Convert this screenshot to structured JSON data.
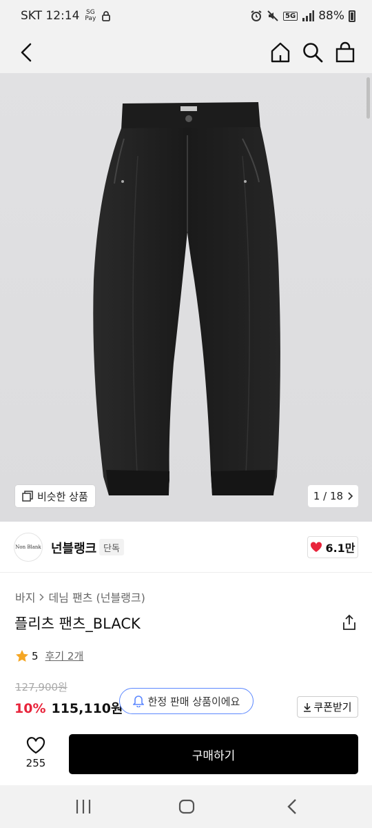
{
  "status_bar": {
    "carrier_time": "SKT 12:14",
    "pay_label_top": "SG",
    "pay_label_bottom": "Pay",
    "network": "5G",
    "battery": "88%",
    "icons": [
      "alarm-icon",
      "mute-icon",
      "signal-icon",
      "battery-icon",
      "lock-icon"
    ]
  },
  "header": {
    "icons": [
      "back-icon",
      "home-icon",
      "search-icon",
      "shopping-bag-icon"
    ]
  },
  "gallery": {
    "similar_label": "비슷한 상품",
    "counter": "1 / 18"
  },
  "brand": {
    "logo_text": "Non Blank",
    "name": "넌블랭크",
    "badge": "단독",
    "likes": "6.1만"
  },
  "product": {
    "breadcrumb": [
      "바지",
      "데님 팬츠 (넌블랭크)"
    ],
    "title": "플리츠 팬츠_BLACK",
    "rating": "5",
    "reviews": "후기 2개",
    "original_price": "127,900원",
    "discount": "10%",
    "price": "115,110원",
    "limited_notice": "한정 판매 상품이에요",
    "coupon_label": "쿠폰받기"
  },
  "bottom_bar": {
    "wish_count": "255",
    "buy_label": "구매하기"
  },
  "colors": {
    "accent_red": "#e8243b",
    "heart_red": "#e8243b",
    "star": "#f5a623",
    "limited_border": "#5b87ff",
    "buy_bg": "#000000"
  }
}
